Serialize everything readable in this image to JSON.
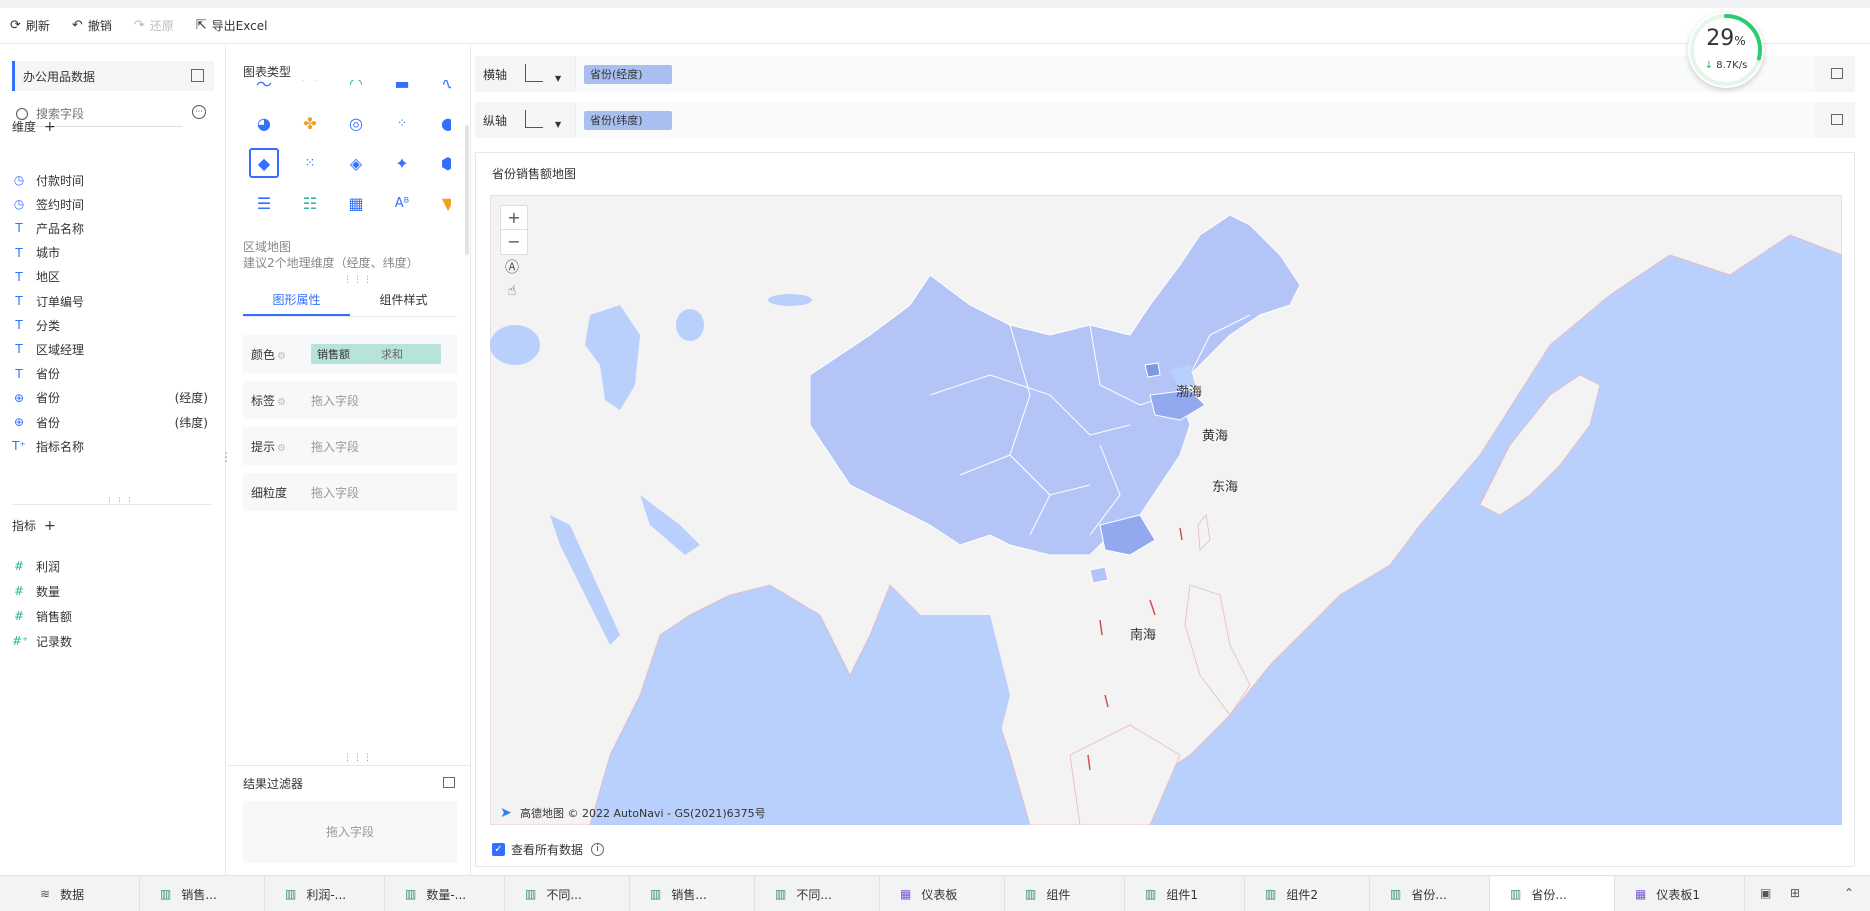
{
  "toolbar": {
    "refresh": "刷新",
    "undo": "撤销",
    "redo": "还原",
    "export": "导出Excel"
  },
  "left": {
    "dataset": "办公用品数据",
    "search_placeholder": "搜索字段",
    "dimension_title": "维度",
    "dimensions": [
      {
        "label": "付款时间",
        "type": "time"
      },
      {
        "label": "签约时间",
        "type": "time"
      },
      {
        "label": "产品名称",
        "type": "text"
      },
      {
        "label": "城市",
        "type": "text"
      },
      {
        "label": "地区",
        "type": "text"
      },
      {
        "label": "订单编号",
        "type": "text"
      },
      {
        "label": "分类",
        "type": "text"
      },
      {
        "label": "区域经理",
        "type": "text"
      },
      {
        "label": "省份",
        "type": "text"
      },
      {
        "label": "省份",
        "type": "geo",
        "suffix": "(经度)"
      },
      {
        "label": "省份",
        "type": "geo",
        "suffix": "(纬度)"
      },
      {
        "label": "指标名称",
        "type": "text-calc"
      }
    ],
    "measure_title": "指标",
    "measures": [
      {
        "label": "利润"
      },
      {
        "label": "数量"
      },
      {
        "label": "销售额"
      },
      {
        "label": "记录数"
      }
    ]
  },
  "middle": {
    "chart_type_title": "图表类型",
    "chart_type_name": "区域地图",
    "chart_type_hint": "建议2个地理维度（经度、纬度）",
    "tabs": [
      "图形属性",
      "组件样式"
    ],
    "props": {
      "color_label": "颜色",
      "color_field": "销售额",
      "color_agg": "求和",
      "label_label": "标签",
      "tooltip_label": "提示",
      "granularity_label": "细粒度",
      "drop_hint": "拖入字段"
    },
    "result_filter_title": "结果过滤器",
    "result_filter_hint": "拖入字段"
  },
  "axes": {
    "x_label": "横轴",
    "x_field": "省份(经度)",
    "y_label": "纵轴",
    "y_field": "省份(纬度)"
  },
  "chart": {
    "title": "省份销售额地图",
    "seas": [
      "渤海",
      "黄海",
      "东海",
      "南海"
    ],
    "copyright": "高德地图 © 2022 AutoNavi - GS(2021)6375号",
    "view_all": "查看所有数据"
  },
  "speed": {
    "percent": "29",
    "percent_unit": "%",
    "rate": "8.7K/s",
    "progress": 0.29
  },
  "bottom_tabs": [
    {
      "label": "数据",
      "icon": "database-icon"
    },
    {
      "label": "销售...",
      "icon": "chart-icon"
    },
    {
      "label": "利润-...",
      "icon": "chart-icon"
    },
    {
      "label": "数量-...",
      "icon": "chart-icon"
    },
    {
      "label": "不同...",
      "icon": "chart-icon"
    },
    {
      "label": "销售...",
      "icon": "chart-icon"
    },
    {
      "label": "不同...",
      "icon": "chart-icon"
    },
    {
      "label": "仪表板",
      "icon": "dashboard-icon"
    },
    {
      "label": "组件",
      "icon": "chart-icon"
    },
    {
      "label": "组件1",
      "icon": "chart-icon"
    },
    {
      "label": "组件2",
      "icon": "chart-icon"
    },
    {
      "label": "省份...",
      "icon": "chart-icon"
    },
    {
      "label": "省份...",
      "icon": "chart-icon",
      "active": true
    },
    {
      "label": "仪表板1",
      "icon": "dashboard-icon"
    }
  ],
  "colors": {
    "accent": "#3370ff",
    "sea": "#b9cffc",
    "land": "#f3f3f3",
    "china": "#b4c4f6",
    "province_dark": "#93a9ef"
  }
}
